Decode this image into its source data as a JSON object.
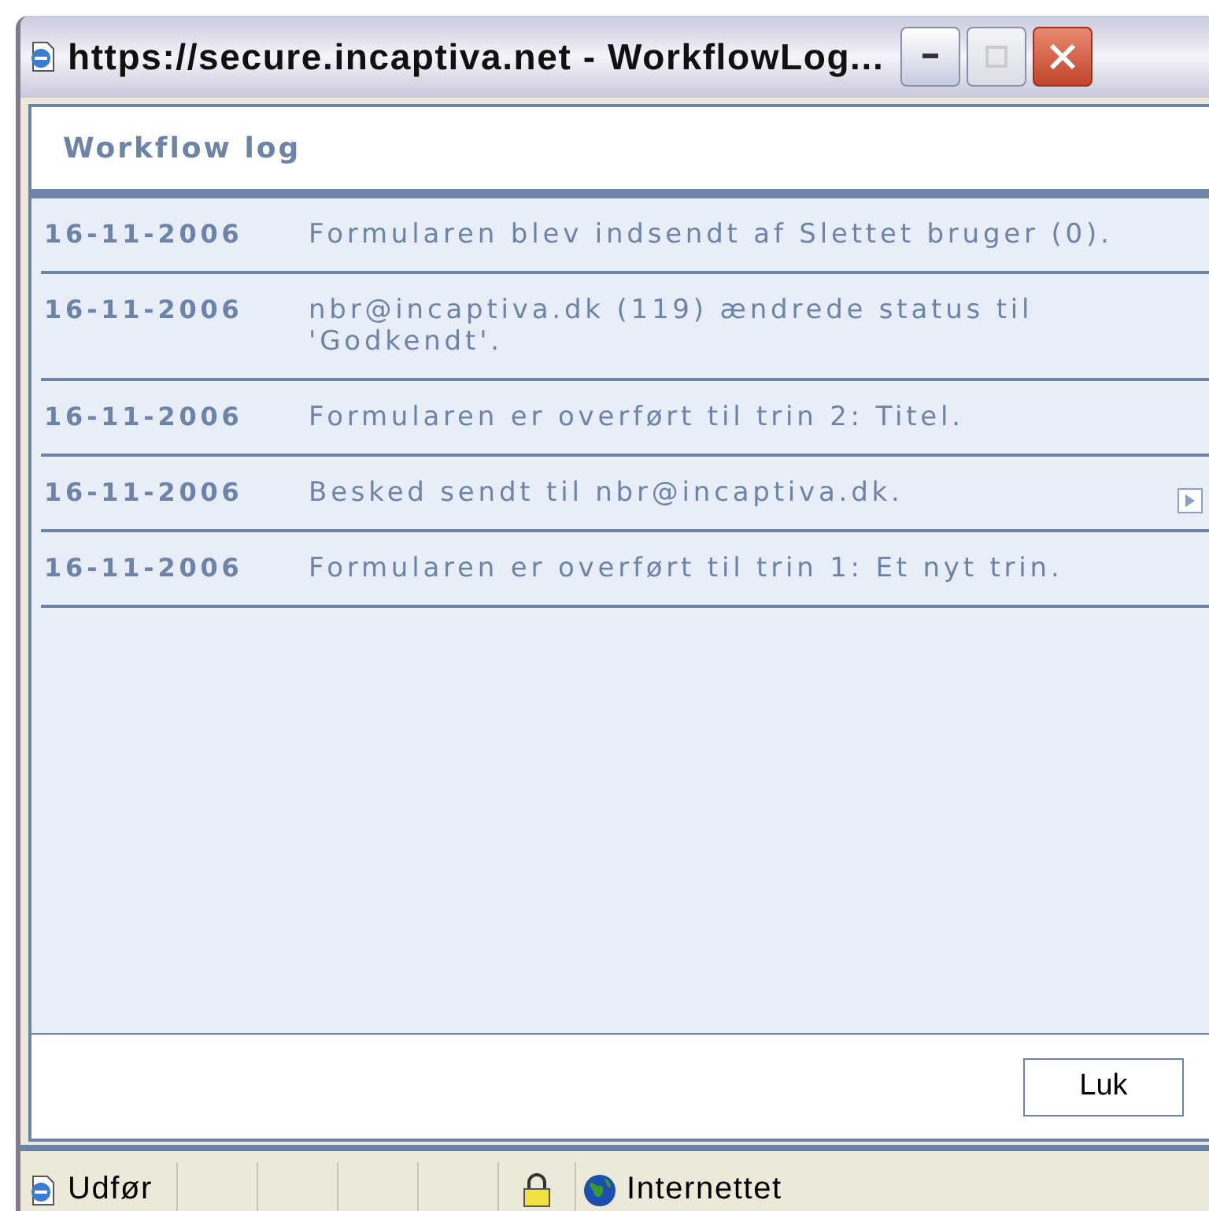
{
  "window": {
    "title": "https://secure.incaptiva.net - WorkflowLog..."
  },
  "header": {
    "title": "Workflow log"
  },
  "log": [
    {
      "date": "16-11-2006",
      "message": "Formularen blev indsendt af Slettet bruger (0).",
      "expand": false
    },
    {
      "date": "16-11-2006",
      "message": "nbr@incaptiva.dk (119) ændrede status til 'Godkendt'.",
      "expand": false
    },
    {
      "date": "16-11-2006",
      "message": "Formularen er overført til trin 2: Titel.",
      "expand": false
    },
    {
      "date": "16-11-2006",
      "message": "Besked sendt til nbr@incaptiva.dk.",
      "expand": true
    },
    {
      "date": "16-11-2006",
      "message": "Formularen er overført til trin 1: Et nyt trin.",
      "expand": false
    }
  ],
  "buttons": [
    "Luk"
  ],
  "status_bar": {
    "status": "Udfør",
    "zone": "Internettet",
    "secure": true
  }
}
